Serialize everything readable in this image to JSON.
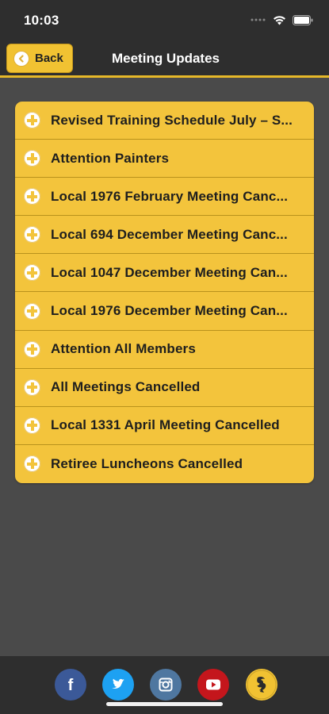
{
  "status_bar": {
    "time": "10:03"
  },
  "nav": {
    "back_label": "Back",
    "title": "Meeting Updates"
  },
  "meetings": [
    "Revised Training Schedule July – S...",
    "Attention Painters",
    "Local 1976 February Meeting Canc...",
    "Local 694 December Meeting Canc...",
    "Local 1047 December Meeting Can...",
    "Local 1976 December Meeting Can...",
    "Attention All Members",
    "All Meetings Cancelled",
    "Local 1331 April Meeting Cancelled",
    "Retiree Luncheons Cancelled"
  ],
  "social_links": [
    {
      "icon": "facebook-icon",
      "glyph": "f",
      "color": "#3b5998"
    },
    {
      "icon": "twitter-icon",
      "glyph": "",
      "color": "#1da1f2"
    },
    {
      "icon": "instagram-icon",
      "glyph": "",
      "color": "#4f77a0"
    },
    {
      "icon": "youtube-icon",
      "glyph": "",
      "color": "#c4161c"
    },
    {
      "icon": "union-logo-icon",
      "glyph": "",
      "color": "#f1c232"
    }
  ],
  "colors": {
    "accent": "#f3c43c",
    "bar": "#2e2e2e",
    "background": "#4a4a4a"
  }
}
